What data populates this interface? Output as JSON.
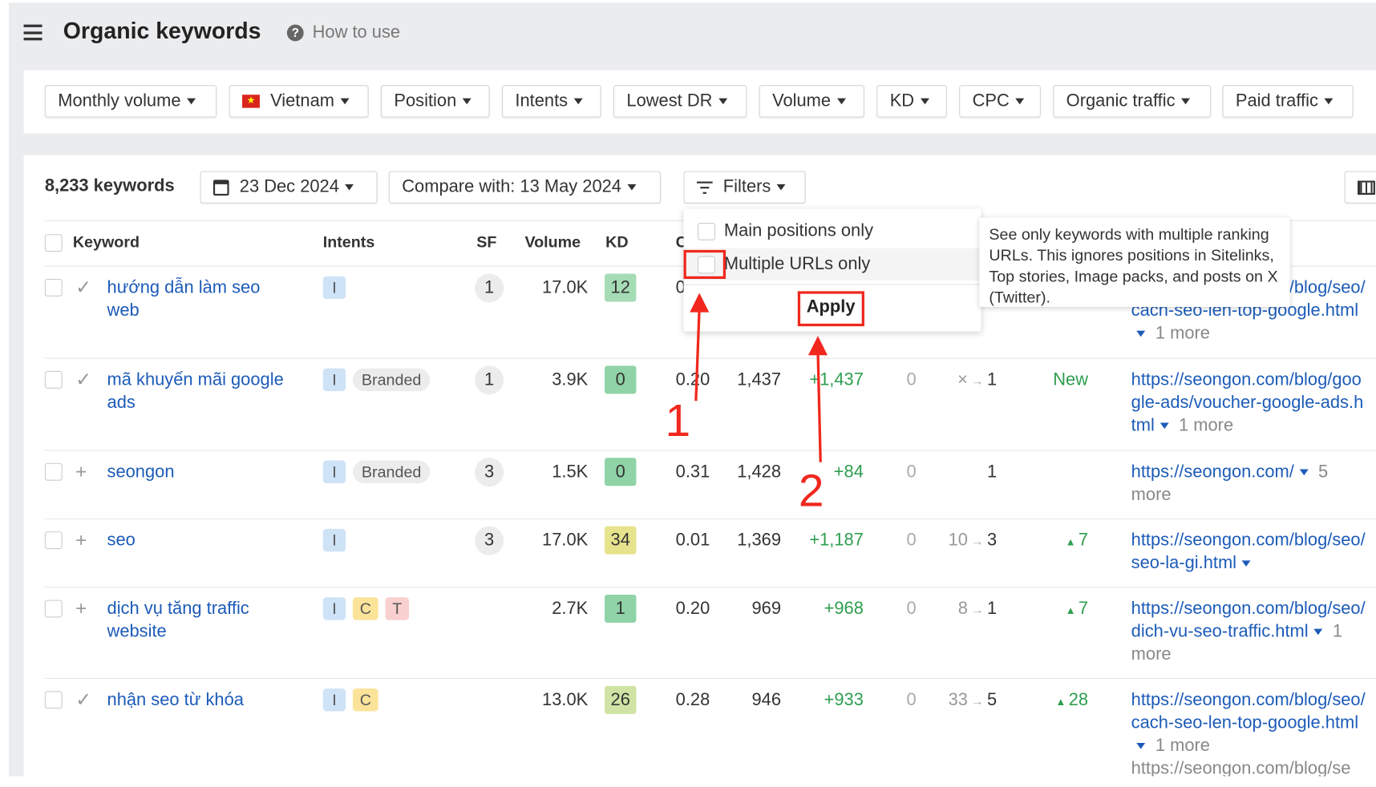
{
  "header": {
    "title": "Organic keywords",
    "help_label": "How to use"
  },
  "filters": [
    {
      "label": "Monthly volume"
    },
    {
      "label": "Vietnam",
      "flag": "vietnam-flag"
    },
    {
      "label": "Position"
    },
    {
      "label": "Intents"
    },
    {
      "label": "Lowest DR"
    },
    {
      "label": "Volume"
    },
    {
      "label": "KD"
    },
    {
      "label": "CPC"
    },
    {
      "label": "Organic traffic"
    },
    {
      "label": "Paid traffic"
    }
  ],
  "toolbar": {
    "count": "8,233 keywords",
    "date": "23 Dec 2024",
    "compare": "Compare with: 13 May 2024",
    "filters": "Filters"
  },
  "columns": {
    "keyword": "Keyword",
    "intents": "Intents",
    "sf": "SF",
    "volume": "Volume",
    "kd": "KD",
    "cpc": "CPC"
  },
  "rows": [
    {
      "mark": "check",
      "keyword": "hướng dẫn làm seo web",
      "intents": [
        "I"
      ],
      "sf": "1",
      "volume": "17.0K",
      "kd": "12",
      "kd_color": "#a6dcb5",
      "cpc": "0",
      "traffic": "",
      "change": "",
      "paid": "",
      "pos_old": "",
      "pos_new": "",
      "pos_change": "",
      "url": "https://seongon.com/blog/seo/cach-seo-len-top-google.html",
      "more": "1 more"
    },
    {
      "mark": "check",
      "keyword": "mã khuyến mãi google ads",
      "intents": [
        "I",
        "Branded"
      ],
      "sf": "1",
      "volume": "3.9K",
      "kd": "0",
      "kd_color": "#8fd3a6",
      "cpc": "0.20",
      "traffic": "1,437",
      "change": "+1,437",
      "paid": "0",
      "pos_old": "×",
      "pos_new": "1",
      "pos_change": "New",
      "url": "https://seongon.com/blog/google-ads/voucher-google-ads.html",
      "more": "1 more"
    },
    {
      "mark": "plus",
      "keyword": "seongon",
      "intents": [
        "I",
        "Branded"
      ],
      "sf": "3",
      "volume": "1.5K",
      "kd": "0",
      "kd_color": "#8fd3a6",
      "cpc": "0.31",
      "traffic": "1,428",
      "change": "+84",
      "paid": "0",
      "pos_old": "",
      "pos_new": "1",
      "pos_change": "",
      "url": "https://seongon.com/",
      "more": "5 more"
    },
    {
      "mark": "plus",
      "keyword": "seo",
      "intents": [
        "I"
      ],
      "sf": "3",
      "volume": "17.0K",
      "kd": "34",
      "kd_color": "#e6e38c",
      "cpc": "0.01",
      "traffic": "1,369",
      "change": "+1,187",
      "paid": "0",
      "pos_old": "10",
      "pos_new": "3",
      "pos_change": "7",
      "url": "https://seongon.com/blog/seo/seo-la-gi.html",
      "more": ""
    },
    {
      "mark": "plus",
      "keyword": "dịch vụ tăng traffic website",
      "intents": [
        "I",
        "C",
        "T"
      ],
      "sf": "",
      "volume": "2.7K",
      "kd": "1",
      "kd_color": "#8fd3a6",
      "cpc": "0.20",
      "traffic": "969",
      "change": "+968",
      "paid": "0",
      "pos_old": "8",
      "pos_new": "1",
      "pos_change": "7",
      "url": "https://seongon.com/blog/seo/dich-vu-seo-traffic.html",
      "more": "1 more"
    },
    {
      "mark": "check",
      "keyword": "nhận seo từ khóa",
      "intents": [
        "I",
        "C"
      ],
      "sf": "",
      "volume": "13.0K",
      "kd": "26",
      "kd_color": "#cfe4a4",
      "cpc": "0.28",
      "traffic": "946",
      "change": "+933",
      "paid": "0",
      "pos_old": "33",
      "pos_new": "5",
      "pos_change": "28",
      "url": "https://seongon.com/blog/seo/cach-seo-len-top-google.html",
      "more": "1 more",
      "url2": "https://seongon.com/blog/se"
    }
  ],
  "intent_colors": {
    "I": "#cfe3f7",
    "C": "#fbe39a",
    "T": "#f9d0d0",
    "Branded": "#ececec"
  },
  "popup": {
    "option1": "Main positions only",
    "option2": "Multiple URLs only",
    "apply": "Apply"
  },
  "tooltip": "See only keywords with multiple ranking URLs. This ignores positions in Sitelinks, Top stories, Image packs, and posts on X (Twitter).",
  "annotations": {
    "step1": "1",
    "step2": "2",
    "color": "#f0281e"
  }
}
